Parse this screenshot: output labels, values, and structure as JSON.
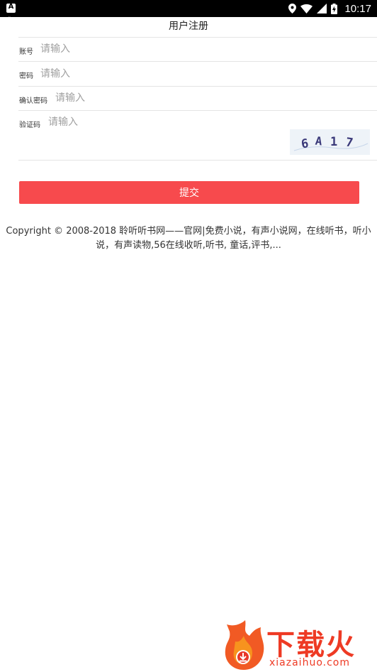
{
  "status_bar": {
    "notification_icon": "a-notification-icon",
    "icons": [
      "location-icon",
      "wifi-icon",
      "signal-icon",
      "battery-charging-icon"
    ],
    "time": "10:17"
  },
  "header": {
    "title": "用户注册",
    "back_icon": "back-dots-icon"
  },
  "form": {
    "account": {
      "label": "账号",
      "placeholder": "请输入",
      "value": ""
    },
    "password": {
      "label": "密码",
      "placeholder": "请输入",
      "value": ""
    },
    "confirm_password": {
      "label": "确认密码",
      "placeholder": "请输入",
      "value": ""
    },
    "captcha": {
      "label": "验证码",
      "placeholder": "请输入",
      "value": "",
      "image_text": "6A17"
    },
    "submit_label": "提交"
  },
  "footer": {
    "copyright_line1": "Copyright © 2008-2018 聆听听书网——官网|免费小说，有声小说网，在线听书，听小",
    "copyright_line2": "说，有声读物,56在线收听,听书, 童话,评书,..."
  },
  "watermark": {
    "brand": "下载火",
    "url": "xiazaihuo.com",
    "brand_color": "#ee3a24"
  },
  "colors": {
    "accent": "#f74a4d",
    "divider": "#e4e4e4",
    "placeholder": "#a0a0a0"
  }
}
